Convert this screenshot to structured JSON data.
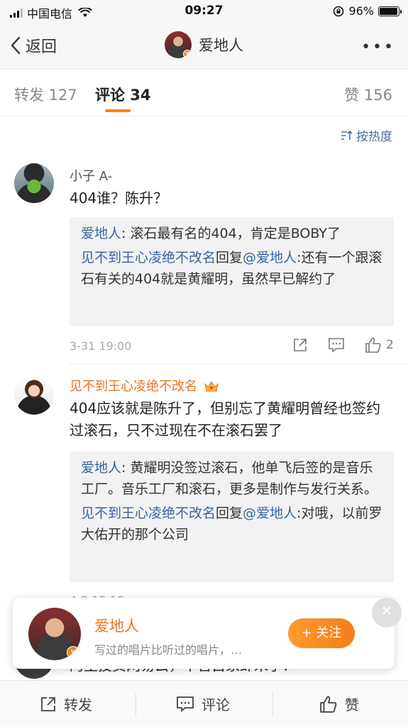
{
  "status": {
    "carrier": "中国电信",
    "time": "09:27",
    "battery": "96%"
  },
  "nav": {
    "back_label": "返回",
    "title": "爱地人"
  },
  "tabs": {
    "repost": "转发 127",
    "comment": "评论 34",
    "like": "赞 156"
  },
  "sort_label": "按热度",
  "comments": [
    {
      "author": "小子 A-",
      "text": "404谁？陈升？",
      "replies": [
        {
          "author": "爱地人",
          "sep": ": ",
          "text": "滚石最有名的404，肯定是BOBY了"
        },
        {
          "author": "见不到王心凌绝不改名",
          "mid": "回复",
          "target": "@爱地人",
          "text": ":还有一个跟滚石有关的404就是黄耀明，虽然早已解约了"
        }
      ],
      "time": "3-31 19:00",
      "likes": "2"
    },
    {
      "author": "见不到王心凌绝不改名",
      "text": "404应该就是陈升了，但别忘了黄耀明曾经也签约过滚石，只不过现在不在滚石罢了",
      "replies": [
        {
          "author": "爱地人",
          "sep": ": ",
          "text": "黄耀明没签过滚石，他单飞后签的是音乐工厂。音乐工厂和滚石，更多是制作与发行关系。"
        },
        {
          "author": "见不到王心凌绝不改名",
          "mid": "回复",
          "target": "@爱地人",
          "text": ":对哦，以前罗大佑开的那个公司"
        }
      ],
      "time": "4-2 15:19"
    },
    {
      "text": "阿里投资网易云，不管自家虾米了？"
    }
  ],
  "card": {
    "name": "爱地人",
    "subtitle": "写过的唱片比听过的唱片，…",
    "follow_label": "+ 关注"
  },
  "bottom": {
    "repost": "转发",
    "comment": "评论",
    "like": "赞"
  },
  "colors": {
    "accent": "#ff8200",
    "link": "#3b62a1",
    "name_orange": "#f2701e"
  }
}
